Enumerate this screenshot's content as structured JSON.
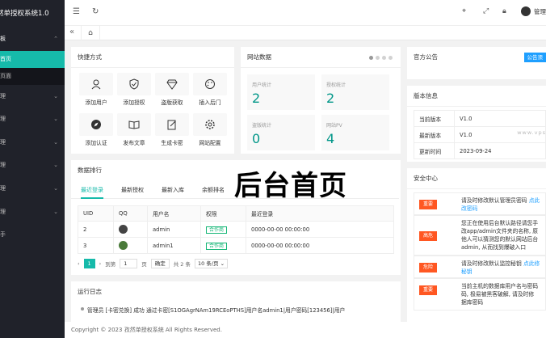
{
  "app": {
    "title": "然单授权系统1.0"
  },
  "sidebar": {
    "section": "板",
    "subs": [
      "首页",
      "页面"
    ],
    "items": [
      "理",
      "理",
      "理",
      "理",
      "理",
      "理",
      "手"
    ]
  },
  "header": {
    "user": "管理"
  },
  "quick": {
    "title": "快捷方式",
    "items": [
      "添加用户",
      "添加授权",
      "盗版获取",
      "插入后门",
      "添加认证",
      "发布文章",
      "生成卡密",
      "网站配置"
    ]
  },
  "stats": {
    "title": "网站数据",
    "cards": [
      {
        "label": "用户统计",
        "value": "2"
      },
      {
        "label": "授权统计",
        "value": "2"
      },
      {
        "label": "盗版统计",
        "value": "0"
      },
      {
        "label": "网站PV",
        "value": "4"
      }
    ]
  },
  "rank": {
    "title": "数据排行",
    "tabs": [
      "最近登录",
      "最新授权",
      "最新入库",
      "余额排名"
    ],
    "columns": [
      "UID",
      "QQ",
      "用户名",
      "权限",
      "最近登录"
    ],
    "rows": [
      {
        "uid": "2",
        "username": "admin",
        "role": "合作商",
        "last": "0000-00-00 00:00:00"
      },
      {
        "uid": "3",
        "username": "admin1",
        "role": "合作商",
        "last": "0000-00-00 00:00:00"
      }
    ],
    "pager": {
      "current": "1",
      "goto_label": "到第",
      "goto_value": "1",
      "page_label": "页",
      "confirm": "确定",
      "total": "共 2 条",
      "size": "10 条/页"
    }
  },
  "overlay": {
    "text": "后台首页"
  },
  "log": {
    "title": "运行日志",
    "entry": "管理员 [卡密兑换] 成功 通过卡密[S1OGAgrNAm19RCEoPTHS]用户名admin1|用户密码[123456]|用户"
  },
  "notice": {
    "title": "官方公告",
    "button": "公告须"
  },
  "version": {
    "title": "版本信息",
    "rows": [
      {
        "k": "当前版本",
        "v": "V1.0"
      },
      {
        "k": "最新版本",
        "v": "V1.0"
      },
      {
        "k": "更新时间",
        "v": "2023-09-24"
      }
    ],
    "watermark": "www.vps"
  },
  "security": {
    "title": "安全中心",
    "items": [
      {
        "badge": "重要",
        "color": "#ff5722",
        "line1": "请及时修改默认管理员密码 ",
        "link": "点此",
        "line2": "改密码",
        "line3": ""
      },
      {
        "badge": "高危",
        "color": "#ff5722",
        "line1": "您正在使用后台默认路径请您手",
        "link": "",
        "line2": "改app/admin文件夹的名称, 原",
        "line3": "他人可以猜测您的默认网站后台",
        "line4": "admin, 从而找到爆破入口"
      },
      {
        "badge": "危险",
        "color": "#ff5722",
        "line1": "请及时修改默认监控秘钥 ",
        "link": "点此修",
        "line2": "秘钥",
        "line3": ""
      },
      {
        "badge": "重要",
        "color": "#ff5722",
        "line1": "当前主机的数据库用户名与密码",
        "link": "",
        "line2": "码, 极易被黑客破解, 请及时修",
        "line3": "据库密码"
      }
    ]
  },
  "footer": {
    "text": "Copyright © 2023 孜然单授权系统 All Rights Reserved."
  },
  "colors": {
    "accent": "#16baaa",
    "sidebar": "#20222a",
    "notice": "#1e9fff",
    "danger": "#ff5722"
  }
}
